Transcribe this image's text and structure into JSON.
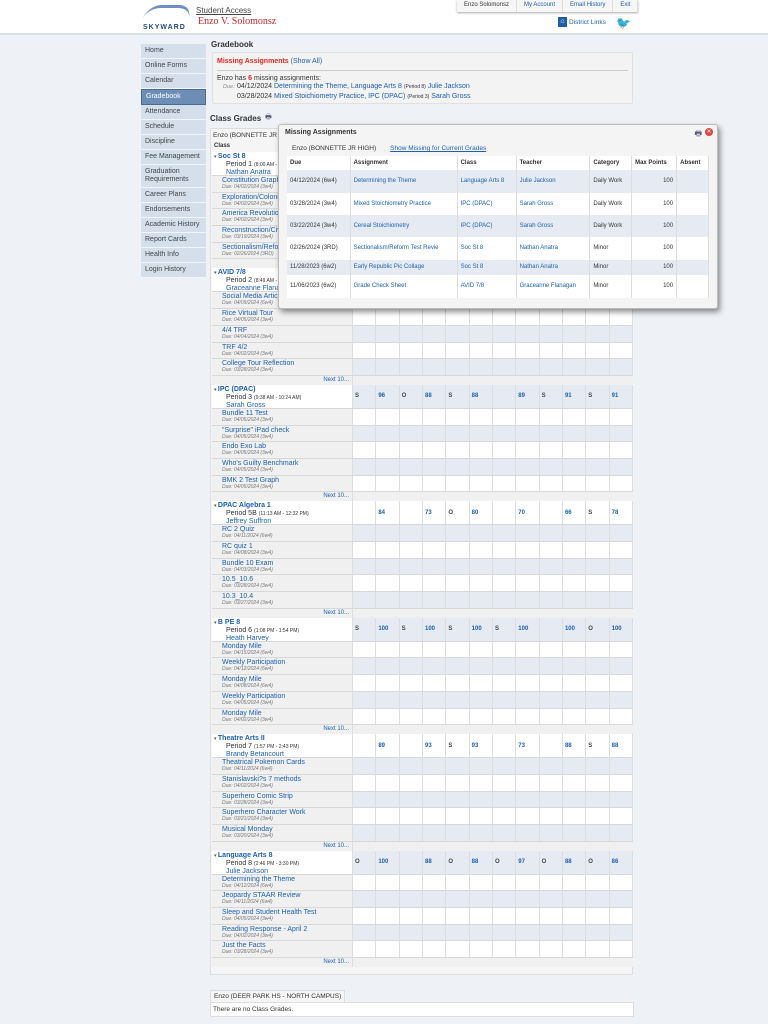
{
  "header": {
    "logo_text": "SKYWARD",
    "app": "Student Access",
    "student": "Enzo V. Solomonsz",
    "top_links": [
      "Enzo Solomonsz",
      "My Account",
      "Email History",
      "Exit"
    ],
    "district_links": "District Links"
  },
  "sidebar": [
    "Home",
    "Online Forms",
    "Calendar",
    "Gradebook",
    "Attendance",
    "Schedule",
    "Discipline",
    "Fee Management",
    "Graduation Requirements",
    "Career Plans",
    "Endorsements",
    "Academic History",
    "Report Cards",
    "Health Info",
    "Login History"
  ],
  "page_title": "Gradebook",
  "missing": {
    "title": "Missing Assignments",
    "show_all": "(Show All)",
    "summary_pre": "Enzo has ",
    "count": "6",
    "summary_post": " missing assignments:",
    "due_label": "Due:",
    "items": [
      {
        "date": "04/12/2024",
        "link": "Determining the Theme, Language Arts 8",
        "period": "(Period 8)",
        "teacher": "Julie Jackson"
      },
      {
        "date": "03/28/2024",
        "link": "Mixed Stoichiometry Practice, IPC (DPAC)",
        "period": "(Period 3)",
        "teacher": "Sarah Gross"
      }
    ]
  },
  "class_grades": {
    "title": "Class Grades",
    "school_tab": "Enzo (BONNETTE JR HIGH)",
    "class_header": "Class",
    "next_label": "Next 10...",
    "classes": [
      {
        "name": "Soc St 8",
        "period": "Period 1",
        "time": "(8:00 AM -",
        "teacher": "Nathan Anatra",
        "grades": [
          "",
          "",
          "",
          "",
          "",
          "",
          "",
          "",
          "",
          "",
          "",
          ""
        ],
        "assignments": [
          [
            "Constitution Graphi",
            "Due: 04/02/2024  (3w4)"
          ],
          [
            "Exploration/Coloniz",
            "Due: 04/02/2024  (3w4)"
          ],
          [
            "America Revolution",
            "Due: 04/02/2024  (3w4)"
          ],
          [
            "Reconstruction/Civ",
            "Due: 03/19/2024  (3w4)"
          ],
          [
            "Sectionalism/Refor",
            "Due: 02/26/2024  (3RD)"
          ]
        ]
      },
      {
        "name": "AVID 7/8",
        "period": "Period 2",
        "time": "(8:49 AM -",
        "teacher": "Graceanne Flanagan",
        "grades": [
          "",
          "",
          "",
          "",
          "",
          "",
          "",
          "",
          "",
          "",
          "",
          ""
        ],
        "assignments": [
          [
            "Social Media Article",
            "Due: 04/09/2024  (6w4)"
          ],
          [
            "Rice Virtual Tour",
            "Due: 04/05/2024  (3w4)"
          ],
          [
            "4/4 TRF",
            "Due: 04/04/2024  (3w4)"
          ],
          [
            "TRF 4/2",
            "Due: 04/02/2024  (3w4)"
          ],
          [
            "College Tour Reflection",
            "Due: 03/28/2024  (3w4)"
          ]
        ]
      },
      {
        "name": "IPC (DPAC)",
        "period": "Period 3",
        "time": "(9:38 AM - 10:24 AM)",
        "teacher": "Sarah Gross",
        "grades": [
          "S",
          "96",
          "O",
          "88",
          "S",
          "88",
          "",
          "89",
          "S",
          "91",
          "S",
          "91"
        ],
        "assignments": [
          [
            "Bundle 11 Test",
            "Due: 04/05/2024  (3w4)"
          ],
          [
            "\"Surprise\" iPad check",
            "Due: 04/05/2024  (3w4)"
          ],
          [
            "Endo Exo Lab",
            "Due: 04/05/2024  (3w4)"
          ],
          [
            "Who's Guilty Benchmark",
            "Due: 04/05/2024  (3w4)"
          ],
          [
            "BMK 2 Test Graph",
            "Due: 04/05/2024  (3w4)"
          ]
        ]
      },
      {
        "name": "DPAC Algebra 1",
        "period": "Period 5B",
        "time": "(11:13 AM - 12:32 PM)",
        "teacher": "Jeffrey Suffron",
        "grades": [
          "",
          "84",
          "",
          "73",
          "O",
          "80",
          "",
          "70",
          "",
          "66",
          "S",
          "78"
        ],
        "assignments": [
          [
            "RC 2 Quiz",
            "Due: 04/11/2024  (6w4)"
          ],
          [
            "RC quiz 1",
            "Due: 04/08/2024  (3w4)"
          ],
          [
            "Bundle 10 Exam",
            "Due: 04/03/2024  (3w4)"
          ],
          [
            "10.5_10.6",
            "Due: 03/28/2024  (3w4)"
          ],
          [
            "10.3_10.4",
            "Due: 03/27/2024  (3w4)"
          ]
        ]
      },
      {
        "name": "B PE 8",
        "period": "Period 6",
        "time": "(1:08 PM - 1:54 PM)",
        "teacher": "Heath Harvey",
        "grades": [
          "S",
          "100",
          "S",
          "100",
          "S",
          "100",
          "S",
          "100",
          "",
          "100",
          "O",
          "100"
        ],
        "assignments": [
          [
            "Monday Mile",
            "Due: 04/15/2024  (6w4)"
          ],
          [
            "Weekly Participation",
            "Due: 04/12/2024  (6w4)"
          ],
          [
            "Monday Mile",
            "Due: 04/08/2024  (6w4)"
          ],
          [
            "Weekly Participation",
            "Due: 04/05/2024  (3w4)"
          ],
          [
            "Monday Mile",
            "Due: 04/02/2024  (3w4)"
          ]
        ]
      },
      {
        "name": "Theatre Arts II",
        "period": "Period 7",
        "time": "(1:57 PM - 2:43 PM)",
        "teacher": "Brandy Betancourt",
        "grades": [
          "",
          "89",
          "",
          "93",
          "S",
          "93",
          "",
          "73",
          "",
          "88",
          "S",
          "88"
        ],
        "assignments": [
          [
            "Theatrical Pokemon Cards",
            "Due: 04/11/2024  (6w4)"
          ],
          [
            "Stanislavski?s 7 methods",
            "Due: 04/02/2024  (3w4)"
          ],
          [
            "Superhero Comic Strip",
            "Due: 03/28/2024  (3w4)"
          ],
          [
            "Superhero Character Work",
            "Due: 03/21/2024  (3w4)"
          ],
          [
            "Musical Monday",
            "Due: 03/20/2024  (3w4)"
          ]
        ]
      },
      {
        "name": "Language Arts 8",
        "period": "Period 8",
        "time": "(2:46 PM - 3:30 PM)",
        "teacher": "Julie Jackson",
        "grades": [
          "O",
          "100",
          "",
          "88",
          "O",
          "88",
          "O",
          "97",
          "O",
          "88",
          "O",
          "86"
        ],
        "assignments": [
          [
            "Determining the Theme",
            "Due: 04/12/2024  (6w4)"
          ],
          [
            "Jeopardy STAAR Review",
            "Due: 04/11/2024  (6w4)"
          ],
          [
            "Sleep and Student Health Test",
            "Due: 04/05/2024  (3w4)"
          ],
          [
            "Reading Response - April 2",
            "Due: 04/02/2024  (3w4)"
          ],
          [
            "Just the Facts",
            "Due: 03/28/2024  (3w4)"
          ]
        ]
      }
    ]
  },
  "popup": {
    "title": "Missing Assignments",
    "school_tab": "Enzo (BONNETTE JR HIGH)",
    "show_link": "Show Missing for Current Grades",
    "columns": [
      "Due",
      "Assignment",
      "Class",
      "Teacher",
      "Category",
      "Max Points",
      "Absent"
    ],
    "rows": [
      [
        "04/12/2024  (6w4)",
        "Determining the Theme",
        "Language Arts 8",
        "Julie Jackson",
        "Daily Work",
        "100",
        ""
      ],
      [
        "03/28/2024  (3w4)",
        "Mixed Stoichiometry Practice",
        "IPC (DPAC)",
        "Sarah Gross",
        "Daily Work",
        "100",
        ""
      ],
      [
        "03/22/2024  (3w4)",
        "Cereal Stoichiometry",
        "IPC (DPAC)",
        "Sarah Gross",
        "Daily Work",
        "100",
        ""
      ],
      [
        "02/26/2024  (3RD)",
        "Sectionalism/Reform Test Revie",
        "Soc St 8",
        "Nathan Anatra",
        "Minor",
        "100",
        ""
      ],
      [
        "11/28/2023  (6w2)",
        "Early Republic Pic Collage",
        "Soc St 8",
        "Nathan Anatra",
        "Minor",
        "100",
        ""
      ],
      [
        "11/06/2023  (6w2)",
        "Grade Check Sheet",
        "AVID 7/8",
        "Graceanne Flanagan",
        "Minor",
        "100",
        ""
      ]
    ]
  },
  "footer": {
    "school_tab": "Enzo (DEER PARK HS - NORTH CAMPUS)",
    "message": "There are no Class Grades."
  }
}
